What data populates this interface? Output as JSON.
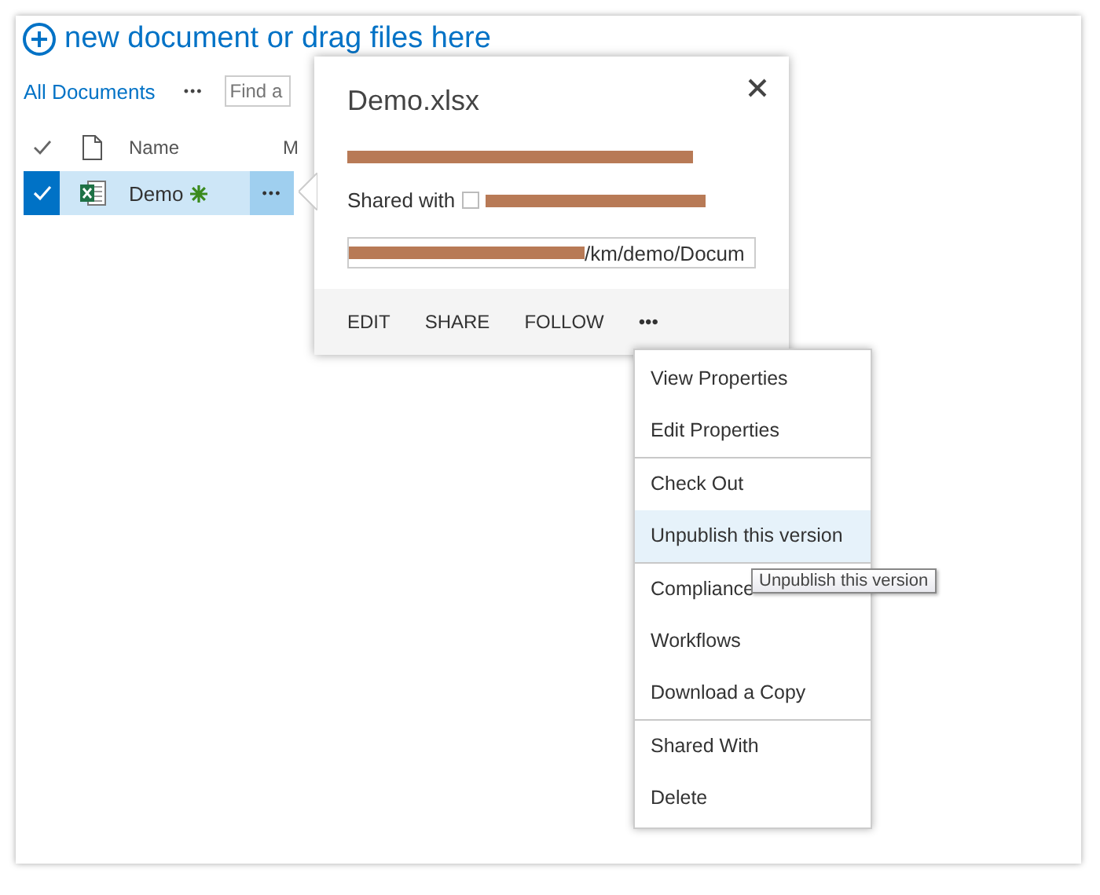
{
  "new_document_link": "new document or drag files here",
  "view": {
    "label": "All Documents",
    "more": "•••"
  },
  "search": {
    "placeholder": "Find a"
  },
  "table": {
    "columns": [
      {
        "label": "Name"
      },
      {
        "label": "M"
      }
    ],
    "rows": [
      {
        "name": "Demo",
        "selected": true,
        "more": "•••"
      }
    ]
  },
  "callout": {
    "title": "Demo.xlsx",
    "shared_with_label": "Shared with",
    "url_tail": "/km/demo/Docum",
    "actions": [
      "EDIT",
      "SHARE",
      "FOLLOW",
      "•••"
    ]
  },
  "menu": {
    "groups": [
      [
        {
          "label": "View Properties",
          "selected": false
        },
        {
          "label": "Edit Properties",
          "selected": false
        }
      ],
      [
        {
          "label": "Check Out",
          "selected": false
        },
        {
          "label": "Unpublish this version",
          "selected": true
        }
      ],
      [
        {
          "label": "Compliance",
          "selected": false
        },
        {
          "label": "Workflows",
          "selected": false
        },
        {
          "label": "Download a Copy",
          "selected": false
        }
      ],
      [
        {
          "label": "Shared With",
          "selected": false
        },
        {
          "label": "Delete",
          "selected": false
        }
      ]
    ]
  },
  "tooltip": {
    "text": "Unpublish this version"
  }
}
